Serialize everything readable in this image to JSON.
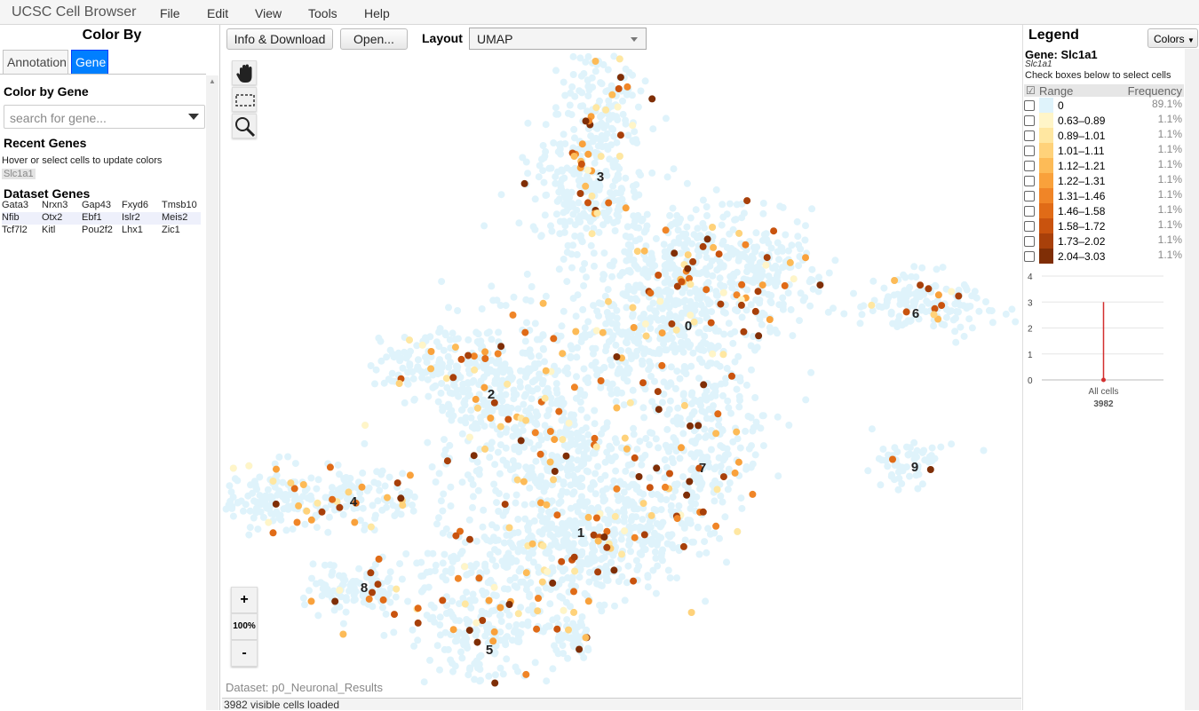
{
  "app": {
    "title": "UCSC Cell Browser"
  },
  "menu": [
    "File",
    "Edit",
    "View",
    "Tools",
    "Help"
  ],
  "left": {
    "title": "Color By",
    "tabs": [
      "Annotation",
      "Gene"
    ],
    "active_tab": "Gene",
    "color_by_gene_label": "Color by Gene",
    "search_placeholder": "search for gene...",
    "recent_genes_label": "Recent Genes",
    "hover_hint": "Hover or select cells to update colors",
    "recent_genes": [
      "Slc1a1"
    ],
    "dataset_genes_label": "Dataset Genes",
    "dataset_genes": [
      [
        "Gata3",
        "Nrxn3",
        "Gap43",
        "Fxyd6",
        "Tmsb10"
      ],
      [
        "Nfib",
        "Otx2",
        "Ebf1",
        "Islr2",
        "Meis2"
      ],
      [
        "Tcf7l2",
        "Kitl",
        "Pou2f2",
        "Lhx1",
        "Zic1"
      ]
    ]
  },
  "toolbar": {
    "info_button": "Info & Download",
    "open_button": "Open...",
    "layout_label": "Layout",
    "layout_value": "UMAP"
  },
  "plot": {
    "tools": [
      "pan-hand-icon",
      "select-rectangle-icon",
      "zoom-magnifier-icon"
    ],
    "zoom_in": "+",
    "zoom_level": "100%",
    "zoom_out": "-",
    "cluster_labels": [
      "0",
      "1",
      "2",
      "3",
      "4",
      "5",
      "6",
      "7",
      "8",
      "9"
    ],
    "dataset_label": "Dataset: p0_Neuronal_Results",
    "status": "3982 visible cells loaded"
  },
  "legend": {
    "title": "Legend",
    "colors_button": "Colors",
    "gene_title": "Gene: Slc1a1",
    "gene_subtitle": "Slc1a1",
    "hint": "Check boxes below to select cells",
    "header_range": "Range",
    "header_frequency": "Frequency",
    "rows": [
      {
        "range": "0",
        "pct": "89.1%",
        "color": "#dff3fb"
      },
      {
        "range": "0.63–0.89",
        "pct": "1.1%",
        "color": "#fff5c8"
      },
      {
        "range": "0.89–1.01",
        "pct": "1.1%",
        "color": "#ffe7a1"
      },
      {
        "range": "1.01–1.11",
        "pct": "1.1%",
        "color": "#ffd27a"
      },
      {
        "range": "1.12–1.21",
        "pct": "1.1%",
        "color": "#fdbb57"
      },
      {
        "range": "1.22–1.31",
        "pct": "1.1%",
        "color": "#f9a13b"
      },
      {
        "range": "1.31–1.46",
        "pct": "1.1%",
        "color": "#f08527"
      },
      {
        "range": "1.46–1.58",
        "pct": "1.1%",
        "color": "#e06b17"
      },
      {
        "range": "1.58–1.72",
        "pct": "1.1%",
        "color": "#c9530e"
      },
      {
        "range": "1.73–2.02",
        "pct": "1.1%",
        "color": "#a8400a"
      },
      {
        "range": "2.04–3.03",
        "pct": "1.1%",
        "color": "#7f2e06"
      }
    ]
  },
  "chart_data": {
    "type": "bar",
    "categories": [
      "All cells"
    ],
    "values": [
      3
    ],
    "ylim": [
      0,
      4
    ],
    "yticks": [
      "0",
      "1",
      "2",
      "3",
      "4"
    ],
    "xlabel": "3982",
    "grid": true,
    "color": "#d32f2f"
  }
}
